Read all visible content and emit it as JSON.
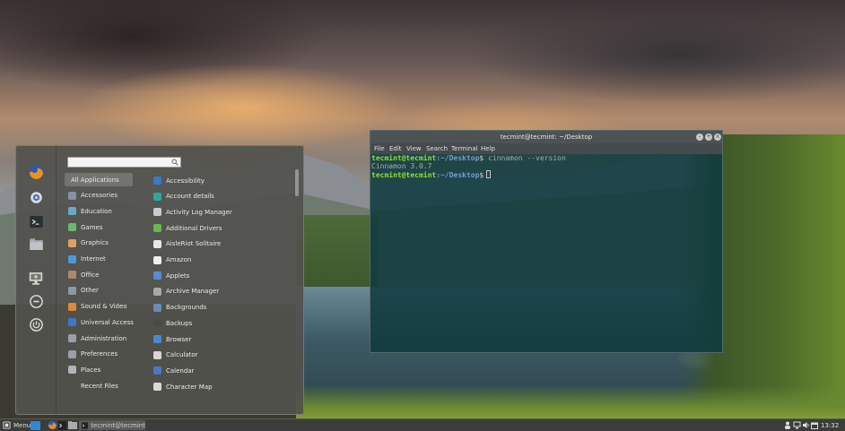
{
  "menu": {
    "search": {
      "value": "",
      "placeholder": ""
    },
    "favorites": [
      {
        "icon": "firefox-icon"
      },
      {
        "icon": "settings-icon"
      },
      {
        "icon": "terminal-icon"
      },
      {
        "icon": "files-icon"
      },
      {
        "icon": "lock-screen-icon"
      },
      {
        "icon": "logout-icon"
      },
      {
        "icon": "power-icon"
      }
    ],
    "categories": [
      {
        "label": "All Applications",
        "icon": "",
        "selected": true
      },
      {
        "label": "Accessories",
        "icon": "accessories-icon",
        "color": "#8a8ea8"
      },
      {
        "label": "Education",
        "icon": "education-icon",
        "color": "#6aa8c8"
      },
      {
        "label": "Games",
        "icon": "games-icon",
        "color": "#6ab86a"
      },
      {
        "label": "Graphics",
        "icon": "graphics-icon",
        "color": "#e0a060"
      },
      {
        "label": "Internet",
        "icon": "internet-icon",
        "color": "#4a9ad8"
      },
      {
        "label": "Office",
        "icon": "office-icon",
        "color": "#b08868"
      },
      {
        "label": "Other",
        "icon": "other-icon",
        "color": "#8a98a8"
      },
      {
        "label": "Sound & Video",
        "icon": "sound-video-icon",
        "color": "#e08a3a"
      },
      {
        "label": "Universal Access",
        "icon": "universal-access-icon",
        "color": "#3a78c8"
      },
      {
        "label": "Administration",
        "icon": "administration-icon",
        "color": "#9aa0a8"
      },
      {
        "label": "Preferences",
        "icon": "preferences-icon",
        "color": "#9aa0a8"
      },
      {
        "label": "Places",
        "icon": "places-icon",
        "color": "#b0b4b8"
      },
      {
        "label": "Recent Files",
        "icon": "",
        "color": ""
      }
    ],
    "apps": [
      {
        "label": "Accessibility",
        "icon": "accessibility-icon",
        "color": "#3a78c8"
      },
      {
        "label": "Account details",
        "icon": "account-details-icon",
        "color": "#2aa8a0"
      },
      {
        "label": "Activity Log Manager",
        "icon": "activity-log-icon",
        "color": "#c8ccd0"
      },
      {
        "label": "Additional Drivers",
        "icon": "additional-drivers-icon",
        "color": "#6ab84a"
      },
      {
        "label": "AisleRiot Solitaire",
        "icon": "solitaire-icon",
        "color": "#e8e8e8"
      },
      {
        "label": "Amazon",
        "icon": "amazon-icon",
        "color": "#f0f0f0"
      },
      {
        "label": "Applets",
        "icon": "applets-icon",
        "color": "#5a8ad0"
      },
      {
        "label": "Archive Manager",
        "icon": "archive-manager-icon",
        "color": "#a8a8a8"
      },
      {
        "label": "Backgrounds",
        "icon": "backgrounds-icon",
        "color": "#6a8ab8"
      },
      {
        "label": "Backups",
        "icon": "backups-icon",
        "color": "#4a4a4a"
      },
      {
        "label": "Browser",
        "icon": "browser-icon",
        "color": "#4a88d0"
      },
      {
        "label": "Calculator",
        "icon": "calculator-icon",
        "color": "#d8d8d0"
      },
      {
        "label": "Calendar",
        "icon": "calendar-icon",
        "color": "#4a78c8"
      },
      {
        "label": "Character Map",
        "icon": "character-map-icon",
        "color": "#d8d8d8"
      }
    ]
  },
  "terminal": {
    "title": "tecmint@tecmint: ~/Desktop",
    "menubar": [
      "File",
      "Edit",
      "View",
      "Search",
      "Terminal",
      "Help"
    ],
    "prompt_user": "tecmint@tecmint",
    "prompt_path": ":~/Desktop",
    "prompt_symbol": "$",
    "command": "cinnamon --version",
    "output": "Cinnamon 3.0.7"
  },
  "taskbar": {
    "menu_label": "Menu",
    "window_label": "tecmint@tecmint",
    "clock": "13:32"
  }
}
